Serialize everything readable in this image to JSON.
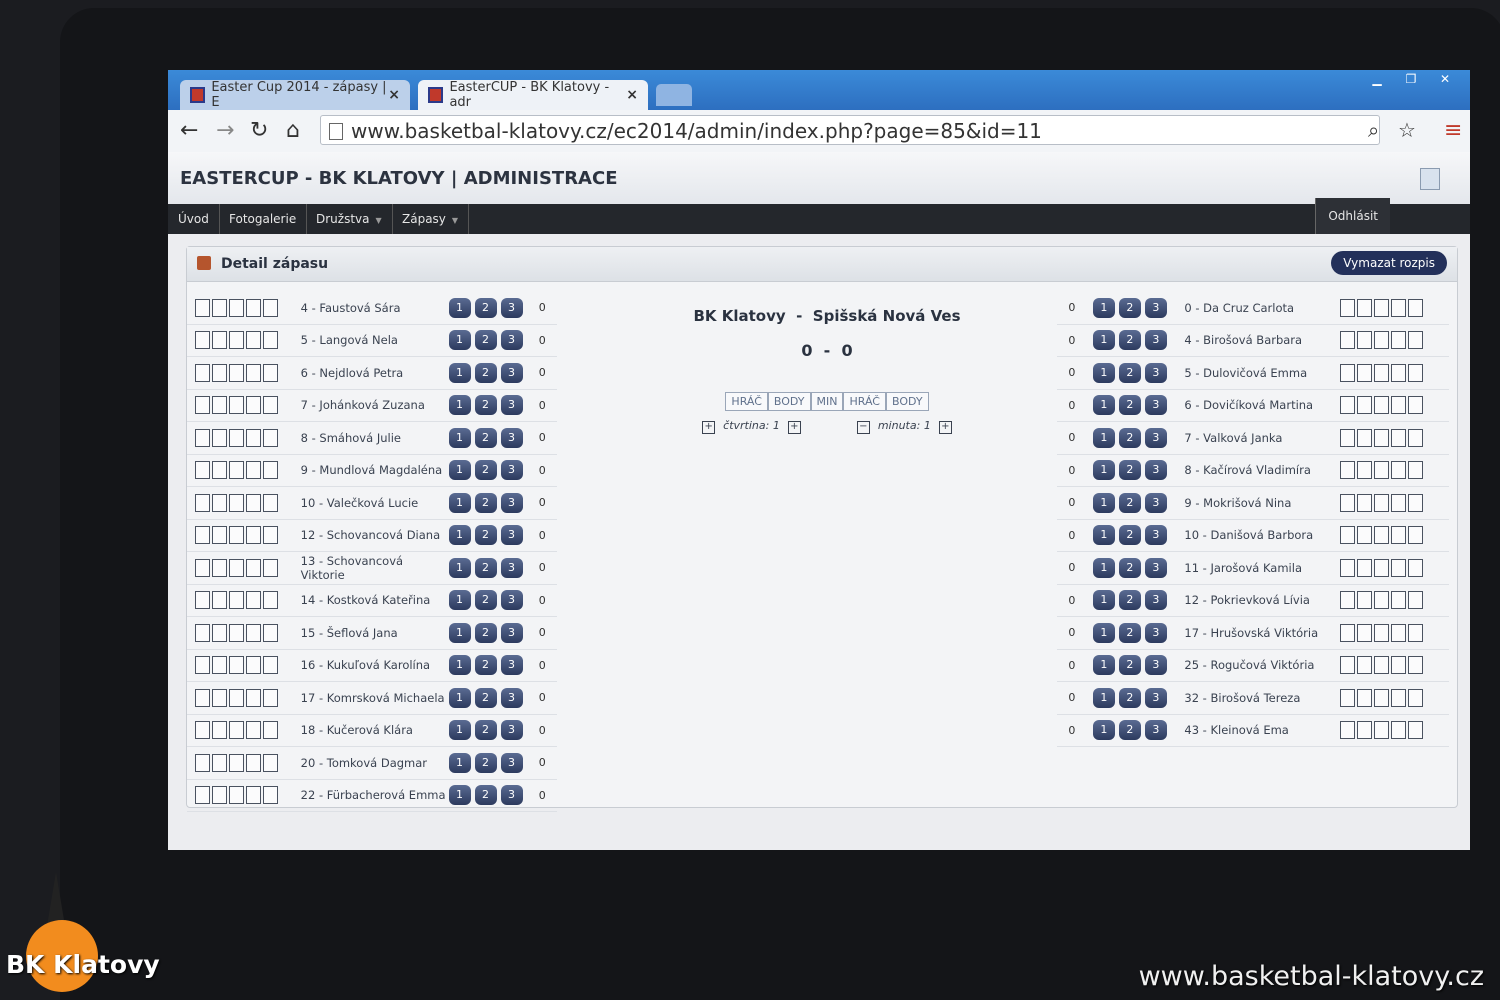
{
  "browser": {
    "tabs": [
      {
        "label": "Easter Cup 2014 - zápasy | E"
      },
      {
        "label": "EasterCUP - BK Klatovy - adr"
      }
    ],
    "close_glyph": "×",
    "url": "www.basketbal-klatovy.cz/ec2014/admin/index.php?page=85&id=11",
    "icons": [
      "back-icon",
      "forward-icon",
      "reload-icon",
      "home-icon",
      "search-icon",
      "star-icon",
      "menu-icon"
    ]
  },
  "app": {
    "title": "EASTERCUP - BK KLATOVY | ADMINISTRACE",
    "menu": [
      "Úvod",
      "Fotogalerie",
      "Družstva",
      "Zápasy"
    ],
    "logout": "Odhlásit"
  },
  "panel": {
    "title": "Detail zápasu",
    "clear_button": "Vymazat rozpis"
  },
  "match": {
    "home": "BK Klatovy",
    "separator": "-",
    "away": "Spišská Nová Ves",
    "score_home": "0",
    "score_away": "0",
    "score_sep": "-",
    "stat_headers": [
      "HRÁČ",
      "BODY",
      "MIN",
      "HRÁČ",
      "BODY"
    ],
    "quarter_label": "čtvrtina: 1",
    "minute_label": "minuta: 1"
  },
  "point_buttons": [
    "1",
    "2",
    "3"
  ],
  "home_players": [
    {
      "name": "4 - Faustová Sára",
      "points": "0"
    },
    {
      "name": "5 - Langová Nela",
      "points": "0"
    },
    {
      "name": "6 - Nejdlová Petra",
      "points": "0"
    },
    {
      "name": "7 - Johánková Zuzana",
      "points": "0"
    },
    {
      "name": "8 - Smáhová Julie",
      "points": "0"
    },
    {
      "name": "9 - Mundlová Magdaléna",
      "points": "0"
    },
    {
      "name": "10 - Valečková Lucie",
      "points": "0"
    },
    {
      "name": "12 - Schovancová Diana",
      "points": "0"
    },
    {
      "name": "13 - Schovancová Viktorie",
      "points": "0"
    },
    {
      "name": "14 - Kostková Kateřina",
      "points": "0"
    },
    {
      "name": "15 - Šeflová Jana",
      "points": "0"
    },
    {
      "name": "16 - Kukuľová Karolína",
      "points": "0"
    },
    {
      "name": "17 - Komrsková Michaela",
      "points": "0"
    },
    {
      "name": "18 - Kučerová Klára",
      "points": "0"
    },
    {
      "name": "20 - Tomková Dagmar",
      "points": "0"
    },
    {
      "name": "22 - Fürbacherová Emma",
      "points": "0"
    }
  ],
  "away_players": [
    {
      "name": "0 - Da Cruz Carlota",
      "points": "0"
    },
    {
      "name": "4 - Birošová Barbara",
      "points": "0"
    },
    {
      "name": "5 - Dulovičová Emma",
      "points": "0"
    },
    {
      "name": "6 - Dovičíková Martina",
      "points": "0"
    },
    {
      "name": "7 - Valková Janka",
      "points": "0"
    },
    {
      "name": "8 - Kačírová Vladimíra",
      "points": "0"
    },
    {
      "name": "9 - Mokrišová Nina",
      "points": "0"
    },
    {
      "name": "10 - Danišová Barbora",
      "points": "0"
    },
    {
      "name": "11 - Jarošová Kamila",
      "points": "0"
    },
    {
      "name": "12 - Pokrievková Lívia",
      "points": "0"
    },
    {
      "name": "17 - Hrušovská Viktória",
      "points": "0"
    },
    {
      "name": "25 - Rogučová Viktória",
      "points": "0"
    },
    {
      "name": "32 - Birošová Tereza",
      "points": "0"
    },
    {
      "name": "43 - Kleinová Ema",
      "points": "0"
    }
  ],
  "watermark": {
    "url": "www.basketbal-klatovy.cz",
    "logo_text": "BK Klatovy"
  }
}
